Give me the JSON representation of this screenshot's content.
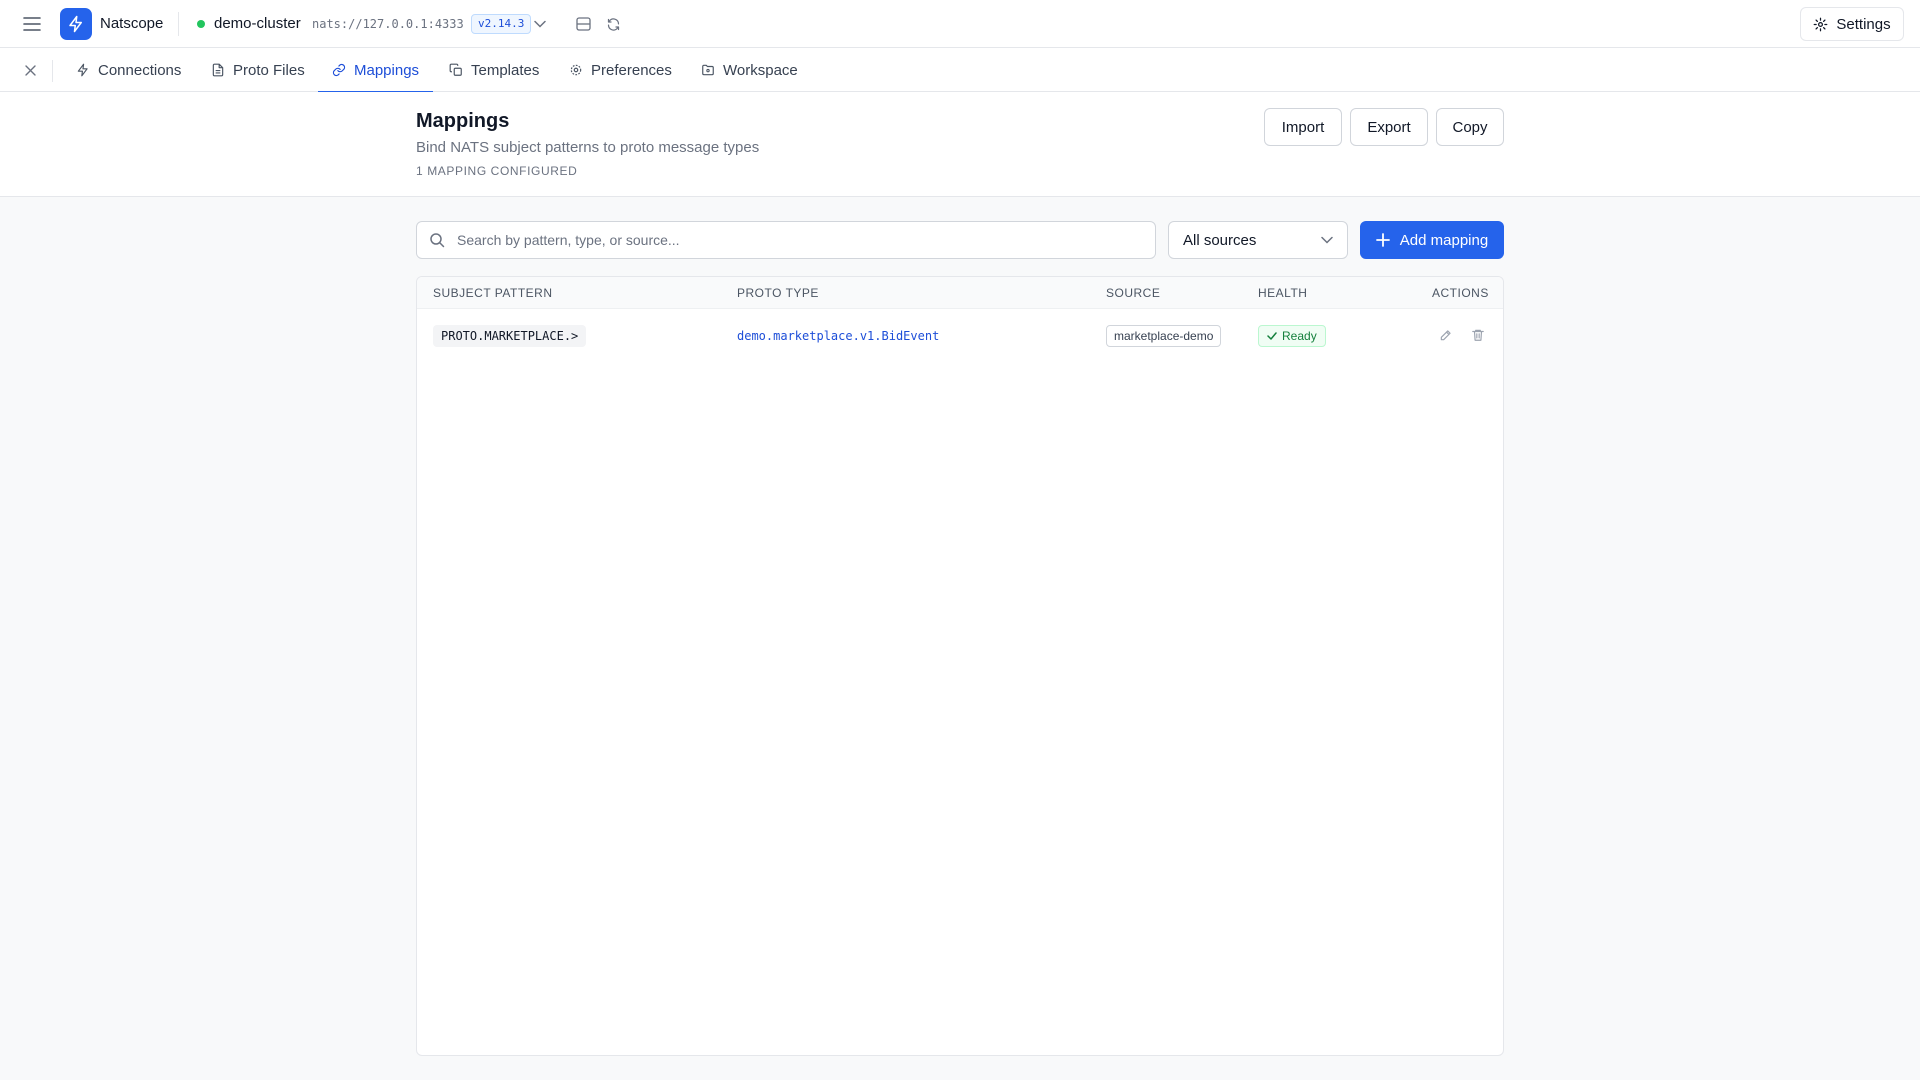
{
  "topbar": {
    "app_name": "Natscope",
    "cluster_name": "demo-cluster",
    "cluster_url": "nats://127.0.0.1:4333",
    "version": "v2.14.3",
    "status_color": "#22c55e",
    "settings_label": "Settings"
  },
  "tabs": [
    {
      "label": "Connections",
      "icon": "bolt-icon"
    },
    {
      "label": "Proto Files",
      "icon": "file-icon"
    },
    {
      "label": "Mappings",
      "icon": "link-icon",
      "active": true
    },
    {
      "label": "Templates",
      "icon": "copy-icon"
    },
    {
      "label": "Preferences",
      "icon": "gear-icon"
    },
    {
      "label": "Workspace",
      "icon": "folder-icon"
    }
  ],
  "page": {
    "title": "Mappings",
    "subtitle": "Bind NATS subject patterns to proto message types",
    "count": "1 MAPPING CONFIGURED",
    "import_label": "Import",
    "export_label": "Export",
    "copy_label": "Copy"
  },
  "toolbar": {
    "search_placeholder": "Search by pattern, type, or source...",
    "source_filter": "All sources",
    "add_label": "Add mapping"
  },
  "table": {
    "columns": [
      "SUBJECT PATTERN",
      "PROTO TYPE",
      "SOURCE",
      "HEALTH",
      "ACTIONS"
    ],
    "rows": [
      {
        "pattern": "PROTO.MARKETPLACE.>",
        "proto_type": "demo.marketplace.v1.BidEvent",
        "source": "marketplace-demo",
        "health": "Ready"
      }
    ]
  },
  "colors": {
    "accent": "#2563eb",
    "ready_green": "#15803d"
  }
}
